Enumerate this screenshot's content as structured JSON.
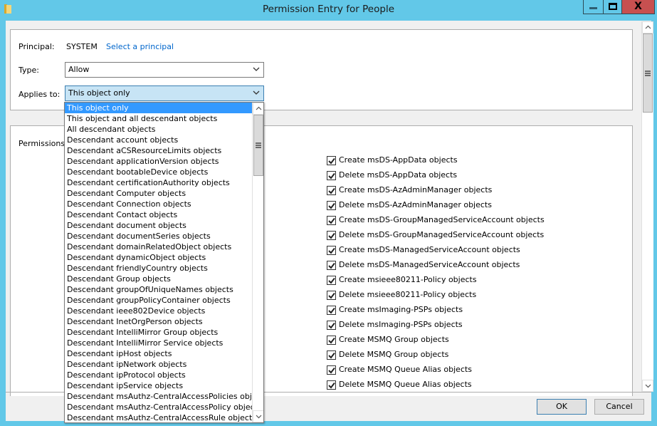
{
  "window": {
    "title": "Permission Entry for People",
    "close_glyph": "X"
  },
  "principal": {
    "label": "Principal:",
    "value": "SYSTEM",
    "link": "Select a principal"
  },
  "type": {
    "label": "Type:",
    "value": "Allow"
  },
  "applies_to": {
    "label": "Applies to:",
    "value": "This object only",
    "options": [
      "This object only",
      "This object and all descendant objects",
      "All descendant objects",
      "Descendant account objects",
      "Descendant aCSResourceLimits objects",
      "Descendant applicationVersion objects",
      "Descendant bootableDevice objects",
      "Descendant certificationAuthority objects",
      "Descendant Computer objects",
      "Descendant Connection objects",
      "Descendant Contact objects",
      "Descendant document objects",
      "Descendant documentSeries objects",
      "Descendant domainRelatedObject objects",
      "Descendant dynamicObject objects",
      "Descendant friendlyCountry objects",
      "Descendant Group objects",
      "Descendant groupOfUniqueNames objects",
      "Descendant groupPolicyContainer objects",
      "Descendant ieee802Device objects",
      "Descendant InetOrgPerson objects",
      "Descendant IntelliMirror Group objects",
      "Descendant IntelliMirror Service objects",
      "Descendant ipHost objects",
      "Descendant ipNetwork objects",
      "Descendant ipProtocol objects",
      "Descendant ipService objects",
      "Descendant msAuthz-CentralAccessPolicies objects",
      "Descendant msAuthz-CentralAccessPolicy objects",
      "Descendant msAuthz-CentralAccessRule objects"
    ],
    "selected_index": 0
  },
  "permissions": {
    "label": "Permissions:",
    "items": [
      {
        "label": "Create msDS-AppData objects",
        "checked": true
      },
      {
        "label": "Delete msDS-AppData objects",
        "checked": true
      },
      {
        "label": "Create msDS-AzAdminManager objects",
        "checked": true
      },
      {
        "label": "Delete msDS-AzAdminManager objects",
        "checked": true
      },
      {
        "label": "Create msDS-GroupManagedServiceAccount objects",
        "checked": true
      },
      {
        "label": "Delete msDS-GroupManagedServiceAccount objects",
        "checked": true
      },
      {
        "label": "Create msDS-ManagedServiceAccount objects",
        "checked": true
      },
      {
        "label": "Delete msDS-ManagedServiceAccount objects",
        "checked": true
      },
      {
        "label": "Create msieee80211-Policy objects",
        "checked": true
      },
      {
        "label": "Delete msieee80211-Policy objects",
        "checked": true
      },
      {
        "label": "Create msImaging-PSPs objects",
        "checked": true
      },
      {
        "label": "Delete msImaging-PSPs objects",
        "checked": true
      },
      {
        "label": "Create MSMQ Group objects",
        "checked": true
      },
      {
        "label": "Delete MSMQ Group objects",
        "checked": true
      },
      {
        "label": "Create MSMQ Queue Alias objects",
        "checked": true
      },
      {
        "label": "Delete MSMQ Queue Alias objects",
        "checked": true
      }
    ]
  },
  "buttons": {
    "ok": "OK",
    "cancel": "Cancel"
  }
}
